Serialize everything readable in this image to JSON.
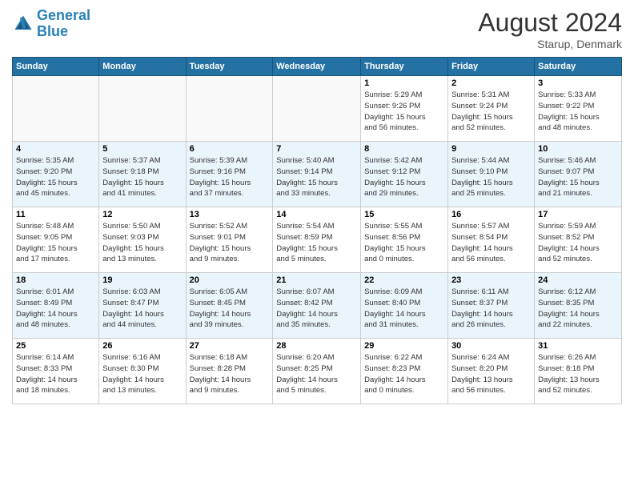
{
  "header": {
    "logo_line1": "General",
    "logo_line2": "Blue",
    "month": "August 2024",
    "location": "Starup, Denmark"
  },
  "weekdays": [
    "Sunday",
    "Monday",
    "Tuesday",
    "Wednesday",
    "Thursday",
    "Friday",
    "Saturday"
  ],
  "weeks": [
    [
      {
        "day": "",
        "info": ""
      },
      {
        "day": "",
        "info": ""
      },
      {
        "day": "",
        "info": ""
      },
      {
        "day": "",
        "info": ""
      },
      {
        "day": "1",
        "info": "Sunrise: 5:29 AM\nSunset: 9:26 PM\nDaylight: 15 hours\nand 56 minutes."
      },
      {
        "day": "2",
        "info": "Sunrise: 5:31 AM\nSunset: 9:24 PM\nDaylight: 15 hours\nand 52 minutes."
      },
      {
        "day": "3",
        "info": "Sunrise: 5:33 AM\nSunset: 9:22 PM\nDaylight: 15 hours\nand 48 minutes."
      }
    ],
    [
      {
        "day": "4",
        "info": "Sunrise: 5:35 AM\nSunset: 9:20 PM\nDaylight: 15 hours\nand 45 minutes."
      },
      {
        "day": "5",
        "info": "Sunrise: 5:37 AM\nSunset: 9:18 PM\nDaylight: 15 hours\nand 41 minutes."
      },
      {
        "day": "6",
        "info": "Sunrise: 5:39 AM\nSunset: 9:16 PM\nDaylight: 15 hours\nand 37 minutes."
      },
      {
        "day": "7",
        "info": "Sunrise: 5:40 AM\nSunset: 9:14 PM\nDaylight: 15 hours\nand 33 minutes."
      },
      {
        "day": "8",
        "info": "Sunrise: 5:42 AM\nSunset: 9:12 PM\nDaylight: 15 hours\nand 29 minutes."
      },
      {
        "day": "9",
        "info": "Sunrise: 5:44 AM\nSunset: 9:10 PM\nDaylight: 15 hours\nand 25 minutes."
      },
      {
        "day": "10",
        "info": "Sunrise: 5:46 AM\nSunset: 9:07 PM\nDaylight: 15 hours\nand 21 minutes."
      }
    ],
    [
      {
        "day": "11",
        "info": "Sunrise: 5:48 AM\nSunset: 9:05 PM\nDaylight: 15 hours\nand 17 minutes."
      },
      {
        "day": "12",
        "info": "Sunrise: 5:50 AM\nSunset: 9:03 PM\nDaylight: 15 hours\nand 13 minutes."
      },
      {
        "day": "13",
        "info": "Sunrise: 5:52 AM\nSunset: 9:01 PM\nDaylight: 15 hours\nand 9 minutes."
      },
      {
        "day": "14",
        "info": "Sunrise: 5:54 AM\nSunset: 8:59 PM\nDaylight: 15 hours\nand 5 minutes."
      },
      {
        "day": "15",
        "info": "Sunrise: 5:55 AM\nSunset: 8:56 PM\nDaylight: 15 hours\nand 0 minutes."
      },
      {
        "day": "16",
        "info": "Sunrise: 5:57 AM\nSunset: 8:54 PM\nDaylight: 14 hours\nand 56 minutes."
      },
      {
        "day": "17",
        "info": "Sunrise: 5:59 AM\nSunset: 8:52 PM\nDaylight: 14 hours\nand 52 minutes."
      }
    ],
    [
      {
        "day": "18",
        "info": "Sunrise: 6:01 AM\nSunset: 8:49 PM\nDaylight: 14 hours\nand 48 minutes."
      },
      {
        "day": "19",
        "info": "Sunrise: 6:03 AM\nSunset: 8:47 PM\nDaylight: 14 hours\nand 44 minutes."
      },
      {
        "day": "20",
        "info": "Sunrise: 6:05 AM\nSunset: 8:45 PM\nDaylight: 14 hours\nand 39 minutes."
      },
      {
        "day": "21",
        "info": "Sunrise: 6:07 AM\nSunset: 8:42 PM\nDaylight: 14 hours\nand 35 minutes."
      },
      {
        "day": "22",
        "info": "Sunrise: 6:09 AM\nSunset: 8:40 PM\nDaylight: 14 hours\nand 31 minutes."
      },
      {
        "day": "23",
        "info": "Sunrise: 6:11 AM\nSunset: 8:37 PM\nDaylight: 14 hours\nand 26 minutes."
      },
      {
        "day": "24",
        "info": "Sunrise: 6:12 AM\nSunset: 8:35 PM\nDaylight: 14 hours\nand 22 minutes."
      }
    ],
    [
      {
        "day": "25",
        "info": "Sunrise: 6:14 AM\nSunset: 8:33 PM\nDaylight: 14 hours\nand 18 minutes."
      },
      {
        "day": "26",
        "info": "Sunrise: 6:16 AM\nSunset: 8:30 PM\nDaylight: 14 hours\nand 13 minutes."
      },
      {
        "day": "27",
        "info": "Sunrise: 6:18 AM\nSunset: 8:28 PM\nDaylight: 14 hours\nand 9 minutes."
      },
      {
        "day": "28",
        "info": "Sunrise: 6:20 AM\nSunset: 8:25 PM\nDaylight: 14 hours\nand 5 minutes."
      },
      {
        "day": "29",
        "info": "Sunrise: 6:22 AM\nSunset: 8:23 PM\nDaylight: 14 hours\nand 0 minutes."
      },
      {
        "day": "30",
        "info": "Sunrise: 6:24 AM\nSunset: 8:20 PM\nDaylight: 13 hours\nand 56 minutes."
      },
      {
        "day": "31",
        "info": "Sunrise: 6:26 AM\nSunset: 8:18 PM\nDaylight: 13 hours\nand 52 minutes."
      }
    ]
  ]
}
